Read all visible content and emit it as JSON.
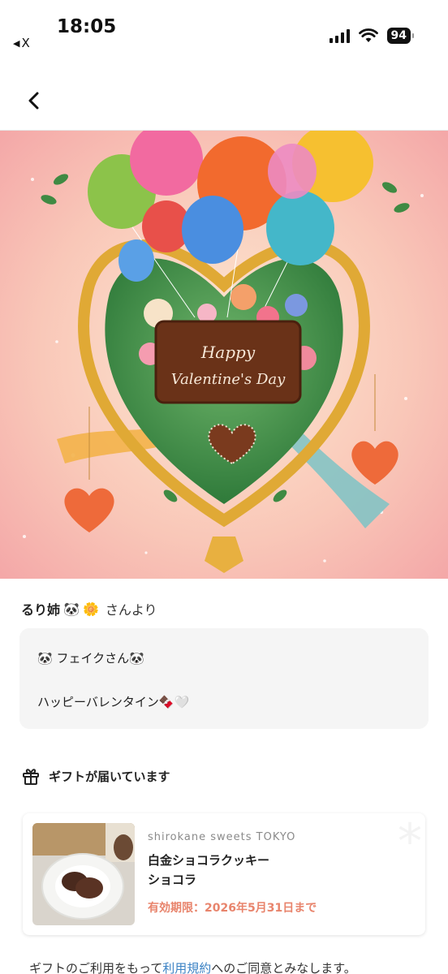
{
  "status_bar": {
    "time": "18:05",
    "back_app": "X",
    "battery": "94"
  },
  "nav": {
    "back_icon": "chevron-left-icon"
  },
  "card_image": {
    "text": "Happy Valentine's Day"
  },
  "sender": {
    "name": "るり姉",
    "suffix": "さんより"
  },
  "message": {
    "line1": "フェイクさん",
    "line2": "ハッピーバレンタイン"
  },
  "gift": {
    "heading": "ギフトが届いています",
    "brand": "shirokane sweets TOKYO",
    "product_line1": "白金ショコラクッキー",
    "product_line2": "ショコラ",
    "expiry": "有効期限：2026年5月31日まで"
  },
  "terms": {
    "prefix": "ギフトのご利用をもって",
    "link": "利用規約",
    "suffix": "へのご同意とみなします。"
  },
  "colors": {
    "accent_expiry": "#e8846c",
    "link": "#3b82c4",
    "message_bg": "#f5f5f5"
  }
}
